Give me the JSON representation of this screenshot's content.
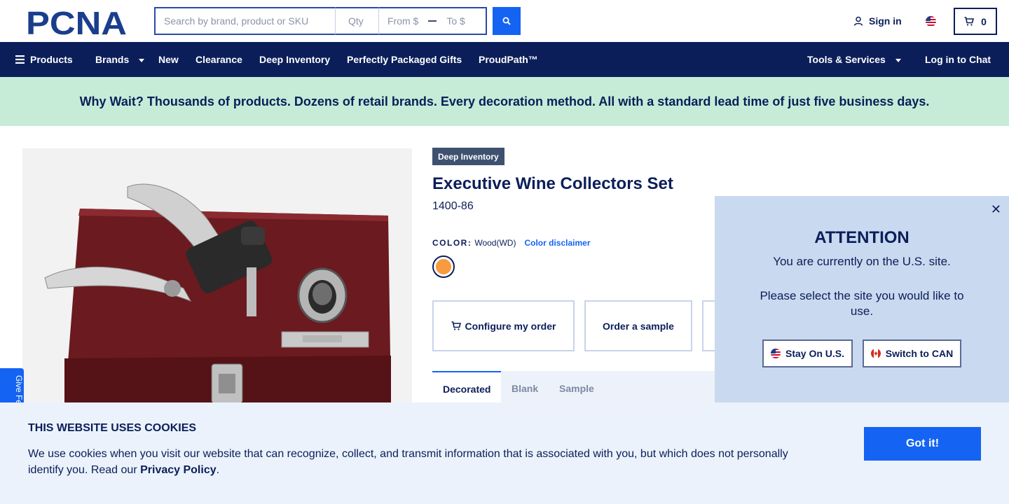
{
  "header": {
    "logo_text": "PCNA",
    "search_placeholder": "Search by brand, product or SKU",
    "qty_placeholder": "Qty",
    "from_placeholder": "From $",
    "to_placeholder": "To $",
    "signin_label": "Sign in",
    "cart_count": "0"
  },
  "nav": {
    "products": "Products",
    "brands": "Brands",
    "new": "New",
    "clearance": "Clearance",
    "deep_inventory": "Deep Inventory",
    "gifts": "Perfectly Packaged Gifts",
    "proudpath": "ProudPath™",
    "tools": "Tools & Services",
    "chat": "Log in to Chat"
  },
  "promo": {
    "text": "Why Wait? Thousands of products. Dozens of retail brands. Every decoration method. All with a standard lead time of just five business days."
  },
  "product": {
    "badge": "Deep Inventory",
    "title": "Executive Wine Collectors Set",
    "sku": "1400-86",
    "color_label": "COLOR:",
    "color_value": "Wood(WD)",
    "color_disclaimer": "Color disclaimer",
    "swatch_color": "#f89a3e",
    "actions": {
      "configure": "Configure my order",
      "sample": "Order a sample"
    },
    "tabs": [
      "Decorated",
      "Blank",
      "Sample"
    ]
  },
  "feedback": {
    "label": "Give Fe"
  },
  "region_modal": {
    "heading": "ATTENTION",
    "message1": "You are currently on the U.S. site.",
    "message2": "Please select the site you would like to use.",
    "stay_label": "Stay On U.S.",
    "switch_label": "Switch to CAN"
  },
  "cookie": {
    "heading": "THIS WEBSITE USES COOKIES",
    "text_before": "We use cookies when you visit our website that can recognize, collect, and transmit information that is associated with you, but which does not personally identify you. Read our ",
    "link": "Privacy Policy",
    "text_after": ".",
    "button": "Got it!"
  },
  "colors": {
    "navy": "#0b1e59",
    "accent": "#1463f3",
    "promo_bg": "#c6ecd7",
    "modal_bg": "#c9d9ef"
  }
}
